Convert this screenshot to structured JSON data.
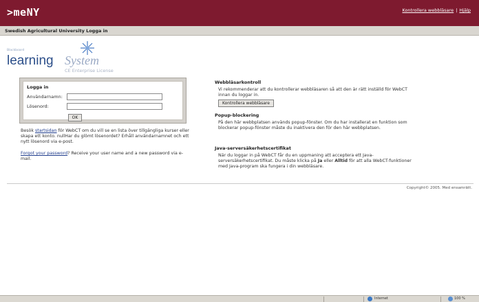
{
  "header": {
    "logo_text": ">meNY",
    "link_browser_check": "Kontrollera webbläsare",
    "separator": "|",
    "link_help": "Hjälp"
  },
  "subheader": {
    "title": "Swedish Agricultural University Logga in"
  },
  "brand": {
    "small_text": "Blackboard",
    "learning": "learning",
    "system": "System",
    "license": "CE Enterprise License",
    "icon": "star-burst-icon"
  },
  "login": {
    "title": "Logga in",
    "username_label": "Användarnamn:",
    "username_value": "",
    "password_label": "Lösenord:",
    "password_value": "",
    "ok_label": "OK"
  },
  "info": {
    "p1_a": "Besök ",
    "p1_link": "startsidan",
    "p1_b": " för WebCT om du vill se en lista över tillgängliga kurser eller skapa ett konto. nullHar du glömt lösenordet? Erhåll användarnamnet och ett nytt lösenord via e-post.",
    "p2_link": "Forgot your password",
    "p2_b": "? Receive your user name and a new password via e-mail."
  },
  "sections": {
    "browser": {
      "title": "Webbläsarkontroll",
      "text": "Vi rekommenderar att du kontrollerar webbläsaren så att den är rätt inställd för WebCT innan du loggar in.",
      "button": "Kontrollera webbläsare"
    },
    "popup": {
      "title": "Popup-blockering",
      "text": "På den här webbplatsen används popup-fönster. Om du har installerat en funktion som blockerar popup-fönster måste du inaktivera den för den här webbplatsen."
    },
    "java": {
      "title": "Java-serversäkerhetscertifikat",
      "text_a": "När du loggar in på WebCT får du en uppmaning att acceptera ett Java-serversäkerhetscertifikat. Du måste klicka på ",
      "bold1": "Ja",
      "text_b": " eller ",
      "bold2": "Alltid",
      "text_c": " för att alla WebCT-funktioner med Java-program ska fungera i din webbläsare."
    }
  },
  "footer": {
    "copyright": "Copyright© 2005. Med ensamrätt."
  },
  "statusbar": {
    "zone": "Internet",
    "zoom": "100 %"
  },
  "colors": {
    "header_bg": "#7e1a2f",
    "subheader_bg": "#d9d6d0",
    "link": "#1f3c8c",
    "brand_blue": "#2c4f8a"
  }
}
